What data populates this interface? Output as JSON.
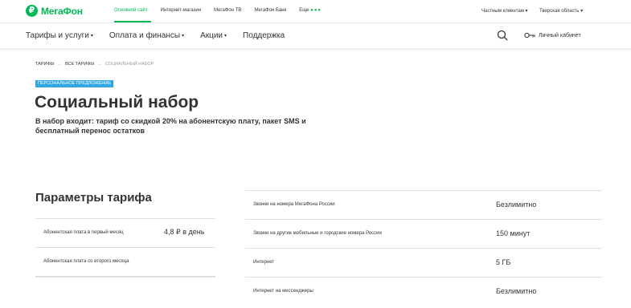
{
  "brand": {
    "logo_mark": "₽",
    "logo_text": "МегаФон",
    "color": "#00b956"
  },
  "topbar": {
    "sites": [
      {
        "label": "Основной сайт",
        "active": true
      },
      {
        "label": "Интернет-магазин",
        "active": false
      },
      {
        "label": "МегаФон ТВ",
        "active": false
      },
      {
        "label": "МегаФон Банк",
        "active": false
      }
    ],
    "more_label": "Еще",
    "more_dots": "●●●",
    "client_type": "Частным клиентам ▾",
    "region": "Тверская область ▾"
  },
  "nav": {
    "items": [
      {
        "label": "Тарифы и услуги",
        "caret": "▾"
      },
      {
        "label": "Оплата и финансы",
        "caret": "▾"
      },
      {
        "label": "Акции",
        "caret": "▾"
      },
      {
        "label": "Поддержка",
        "caret": ""
      }
    ],
    "search_icon": "search-icon",
    "account_icon": "key-icon",
    "account_label": "Личный кабинет"
  },
  "breadcrumb": {
    "items": [
      "Тарифы",
      "Все тарифы",
      "Социальный набор"
    ],
    "separator": "→"
  },
  "badge": {
    "label": "Персональное предложение",
    "color": "#33a7e0"
  },
  "page": {
    "title": "Социальный набор",
    "subtitle": "В набор входит: тариф со скидкой 20% на абонентскую плату, пакет SMS и бесплатный перенос остатков"
  },
  "params": {
    "heading": "Параметры тарифа",
    "left_rows": [
      {
        "label": "Абонентская плата в первый месяц",
        "value": "4,8 ₽ в день"
      },
      {
        "label": "Абонентская плата со второго месяца",
        "value": ""
      }
    ],
    "right_rows": [
      {
        "label": "Звонки на номера МегаФона России",
        "value": "Безлимитно"
      },
      {
        "label": "Звонки на другие мобильные и городские номера России",
        "value": "150 минут"
      },
      {
        "label": "Интернет",
        "value": "5 ГБ"
      },
      {
        "label": "Интернет на мессенджеры",
        "value": "Безлимитно"
      }
    ]
  }
}
